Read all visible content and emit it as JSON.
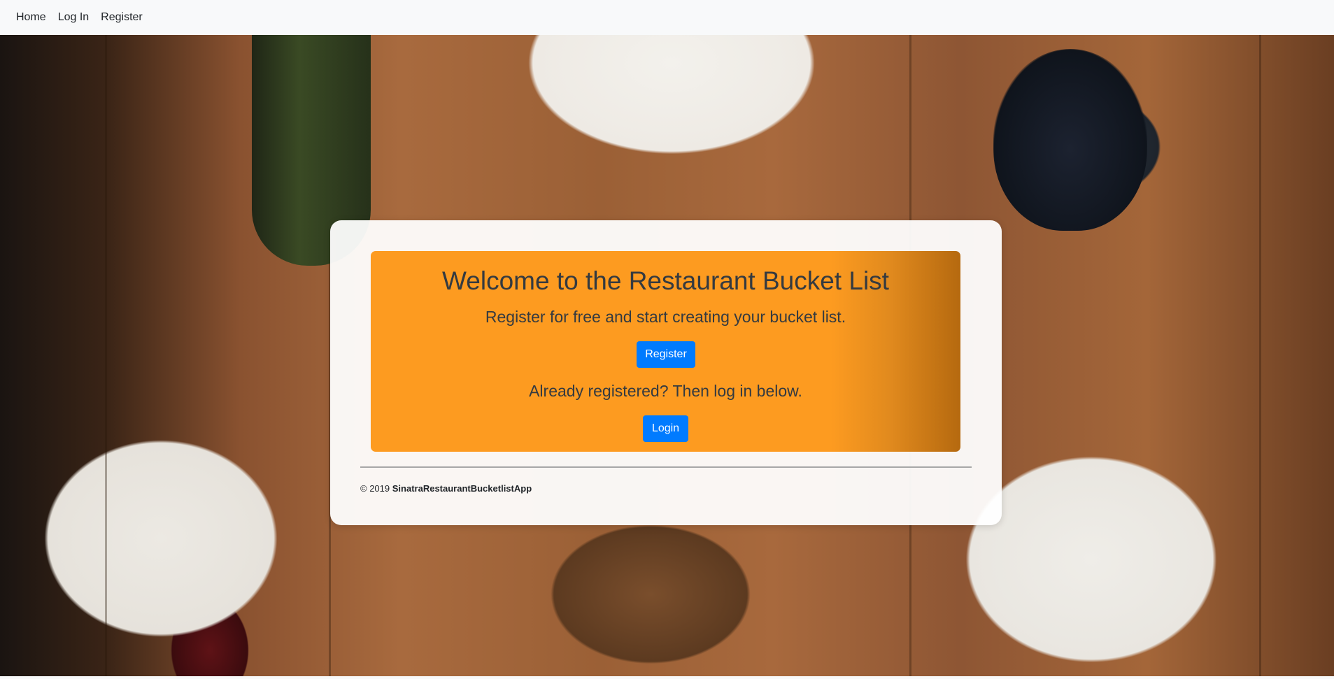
{
  "nav": {
    "items": [
      {
        "label": "Home"
      },
      {
        "label": "Log In"
      },
      {
        "label": "Register"
      }
    ]
  },
  "main": {
    "title": "Welcome to the Restaurant Bucket List",
    "lead": "Register for free and start creating your bucket list.",
    "register_button": "Register",
    "lead2": "Already registered? Then log in below.",
    "login_button": "Login"
  },
  "footer": {
    "copyright": "© 2019",
    "app_name": "SinatraRestaurantBucketlistApp"
  },
  "colors": {
    "jumbotron": "#fd9b20",
    "button": "#007bff",
    "navbar": "#f8f9fa"
  }
}
